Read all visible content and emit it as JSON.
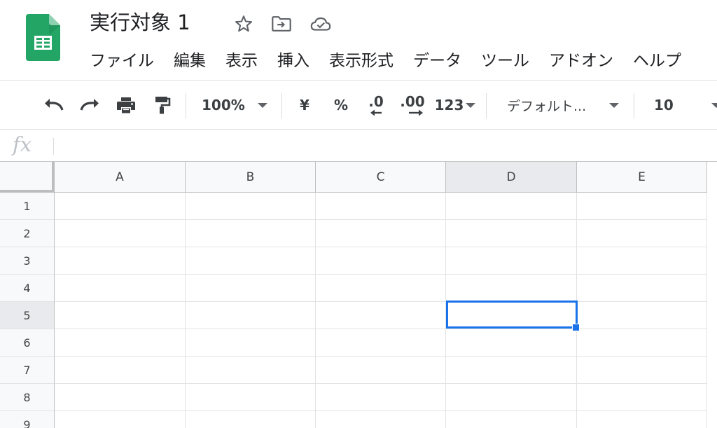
{
  "document": {
    "title": "実行対象 1"
  },
  "title_icons": [
    "star-icon",
    "move-to-folder-icon",
    "cloud-saved-icon"
  ],
  "menu": [
    "ファイル",
    "編集",
    "表示",
    "挿入",
    "表示形式",
    "データ",
    "ツール",
    "アドオン",
    "ヘルプ"
  ],
  "toolbar": {
    "zoom": "100%",
    "currency": "¥",
    "percent": "%",
    "decrease_decimal": ".0",
    "increase_decimal": ".00",
    "more_formats": "123",
    "font": "デフォルト...",
    "font_size": "10"
  },
  "formula_bar": {
    "fx_label": "fx",
    "value": ""
  },
  "columns": [
    "A",
    "B",
    "C",
    "D",
    "E"
  ],
  "rows": [
    "1",
    "2",
    "3",
    "4",
    "5",
    "6",
    "7",
    "8",
    "9"
  ],
  "active_cell": "D5",
  "colors": {
    "accent": "#1a73e8",
    "sheets_green": "#188038"
  }
}
